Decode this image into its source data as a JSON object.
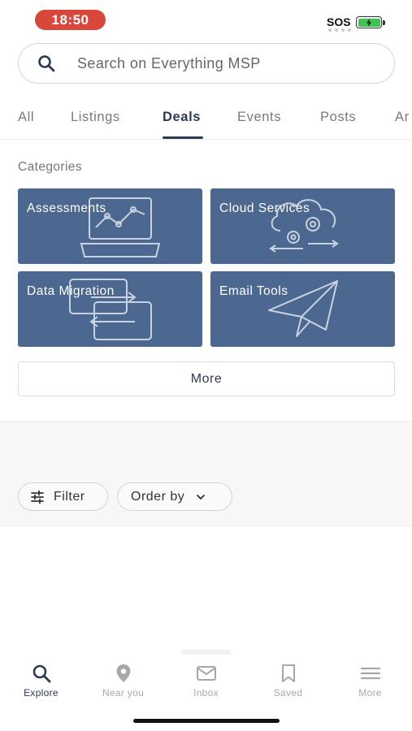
{
  "status_bar": {
    "time": "18:50",
    "sos": "SOS",
    "battery_color": "#3cc552"
  },
  "search": {
    "placeholder": "Search on Everything MSP",
    "icon": "search-icon"
  },
  "tabs": [
    {
      "label": "All",
      "active": false
    },
    {
      "label": "Listings",
      "active": false
    },
    {
      "label": "Deals",
      "active": true
    },
    {
      "label": "Events",
      "active": false
    },
    {
      "label": "Posts",
      "active": false
    },
    {
      "label": "Ar",
      "active": false
    }
  ],
  "categories": {
    "label": "Categories",
    "items": [
      {
        "label": "Assessments",
        "icon": "laptop-chart-icon"
      },
      {
        "label": "Cloud Services",
        "icon": "cloud-gears-icon"
      },
      {
        "label": "Data Migration",
        "icon": "transfer-arrows-icon"
      },
      {
        "label": "Email Tools",
        "icon": "paper-plane-icon"
      }
    ],
    "tile_color": "#4c6890",
    "more_label": "More"
  },
  "filters": {
    "filter_label": "Filter",
    "order_label": "Order by"
  },
  "bottom_nav": [
    {
      "label": "Explore",
      "icon": "search-icon",
      "active": true
    },
    {
      "label": "Near you",
      "icon": "location-pin-icon",
      "active": false
    },
    {
      "label": "Inbox",
      "icon": "mail-icon",
      "active": false
    },
    {
      "label": "Saved",
      "icon": "bookmark-icon",
      "active": false
    },
    {
      "label": "More",
      "icon": "menu-icon",
      "active": false
    }
  ],
  "colors": {
    "accent": "#2b3b55",
    "time_pill": "#d9473a"
  }
}
